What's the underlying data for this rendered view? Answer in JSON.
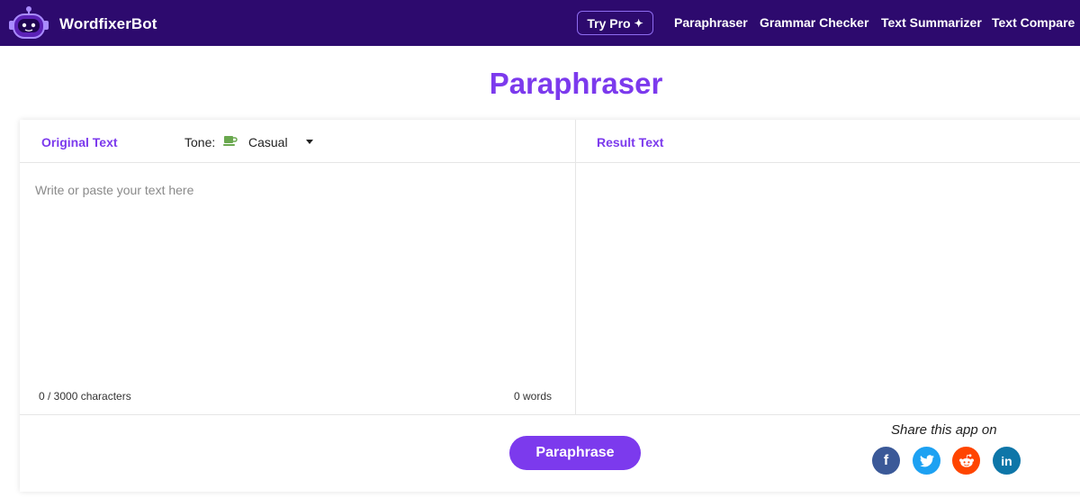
{
  "brand": {
    "name": "WordfixerBot"
  },
  "nav": {
    "try_pro": "Try Pro",
    "links": [
      "Paraphraser",
      "Grammar Checker",
      "Text Summarizer",
      "Text Compare"
    ]
  },
  "page": {
    "title": "Paraphraser"
  },
  "editor": {
    "original_label": "Original Text",
    "tone_label": "Tone:",
    "tone_value": "Casual",
    "input_placeholder": "Write or paste your text here",
    "char_count": "0 / 3000 characters",
    "word_count": "0 words",
    "result_label": "Result Text"
  },
  "actions": {
    "paraphrase": "Paraphrase"
  },
  "share": {
    "label": "Share this app on",
    "networks": [
      "facebook",
      "twitter",
      "reddit",
      "linkedin"
    ]
  },
  "colors": {
    "nav_bg": "#2d0a6e",
    "accent": "#7c3aed",
    "facebook": "#3b5998",
    "twitter": "#1da1f2",
    "reddit": "#ff4500",
    "linkedin": "#0e76a8",
    "tone_icon": "#6aa84f"
  },
  "icons": {
    "logo": "robot-logo-icon",
    "try_pro": "sparkle-icon",
    "tone": "coffee-cup-icon",
    "tone_caret": "caret-down-icon"
  }
}
